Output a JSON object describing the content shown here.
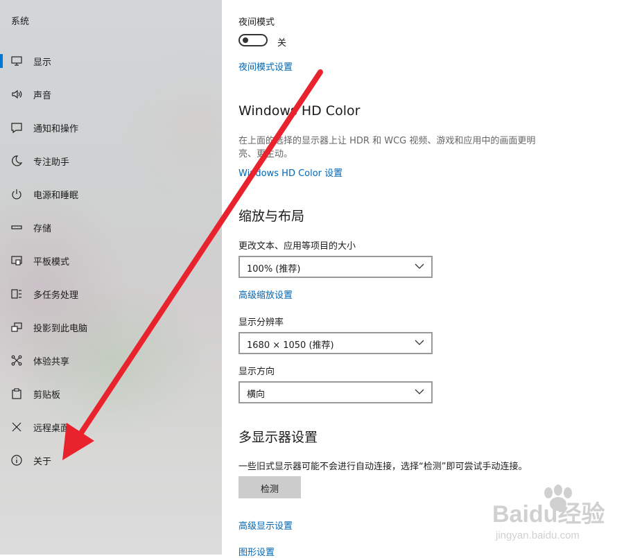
{
  "sidebar": {
    "title": "系统",
    "items": [
      {
        "label": "显示",
        "icon": "monitor-icon",
        "selected": true
      },
      {
        "label": "声音",
        "icon": "speaker-icon"
      },
      {
        "label": "通知和操作",
        "icon": "notification-icon"
      },
      {
        "label": "专注助手",
        "icon": "moon-icon"
      },
      {
        "label": "电源和睡眠",
        "icon": "power-icon"
      },
      {
        "label": "存储",
        "icon": "storage-icon"
      },
      {
        "label": "平板模式",
        "icon": "tablet-mode-icon"
      },
      {
        "label": "多任务处理",
        "icon": "multitasking-icon"
      },
      {
        "label": "投影到此电脑",
        "icon": "project-icon"
      },
      {
        "label": "体验共享",
        "icon": "share-icon"
      },
      {
        "label": "剪贴板",
        "icon": "clipboard-icon"
      },
      {
        "label": "远程桌面",
        "icon": "remote-desktop-icon"
      },
      {
        "label": "关于",
        "icon": "info-icon"
      }
    ]
  },
  "main": {
    "night_mode": {
      "label": "夜间模式",
      "toggle_state": "关",
      "settings_link": "夜间模式设置"
    },
    "hd_color": {
      "heading": "Windows HD Color",
      "description": "在上面的选择的显示器上让 HDR 和 WCG 视频、游戏和应用中的画面更明亮、更生动。",
      "settings_link": "Windows HD Color 设置"
    },
    "scale_layout": {
      "heading": "缩放与布局",
      "scale_label": "更改文本、应用等项目的大小",
      "scale_value": "100% (推荐)",
      "advanced_scale_link": "高级缩放设置",
      "resolution_label": "显示分辨率",
      "resolution_value": "1680 × 1050 (推荐)",
      "orientation_label": "显示方向",
      "orientation_value": "横向"
    },
    "multi_display": {
      "heading": "多显示器设置",
      "description": "一些旧式显示器可能不会进行自动连接，选择“检测”即可尝试手动连接。",
      "detect_button": "检测",
      "advanced_display_link": "高级显示设置",
      "graphics_link": "图形设置"
    }
  },
  "watermark": {
    "brand": "Baidu经验",
    "url": "jingyan.baidu.com"
  },
  "colors": {
    "accent": "#0078d7",
    "link": "#0066b4",
    "annotation_arrow": "#e8232e"
  }
}
